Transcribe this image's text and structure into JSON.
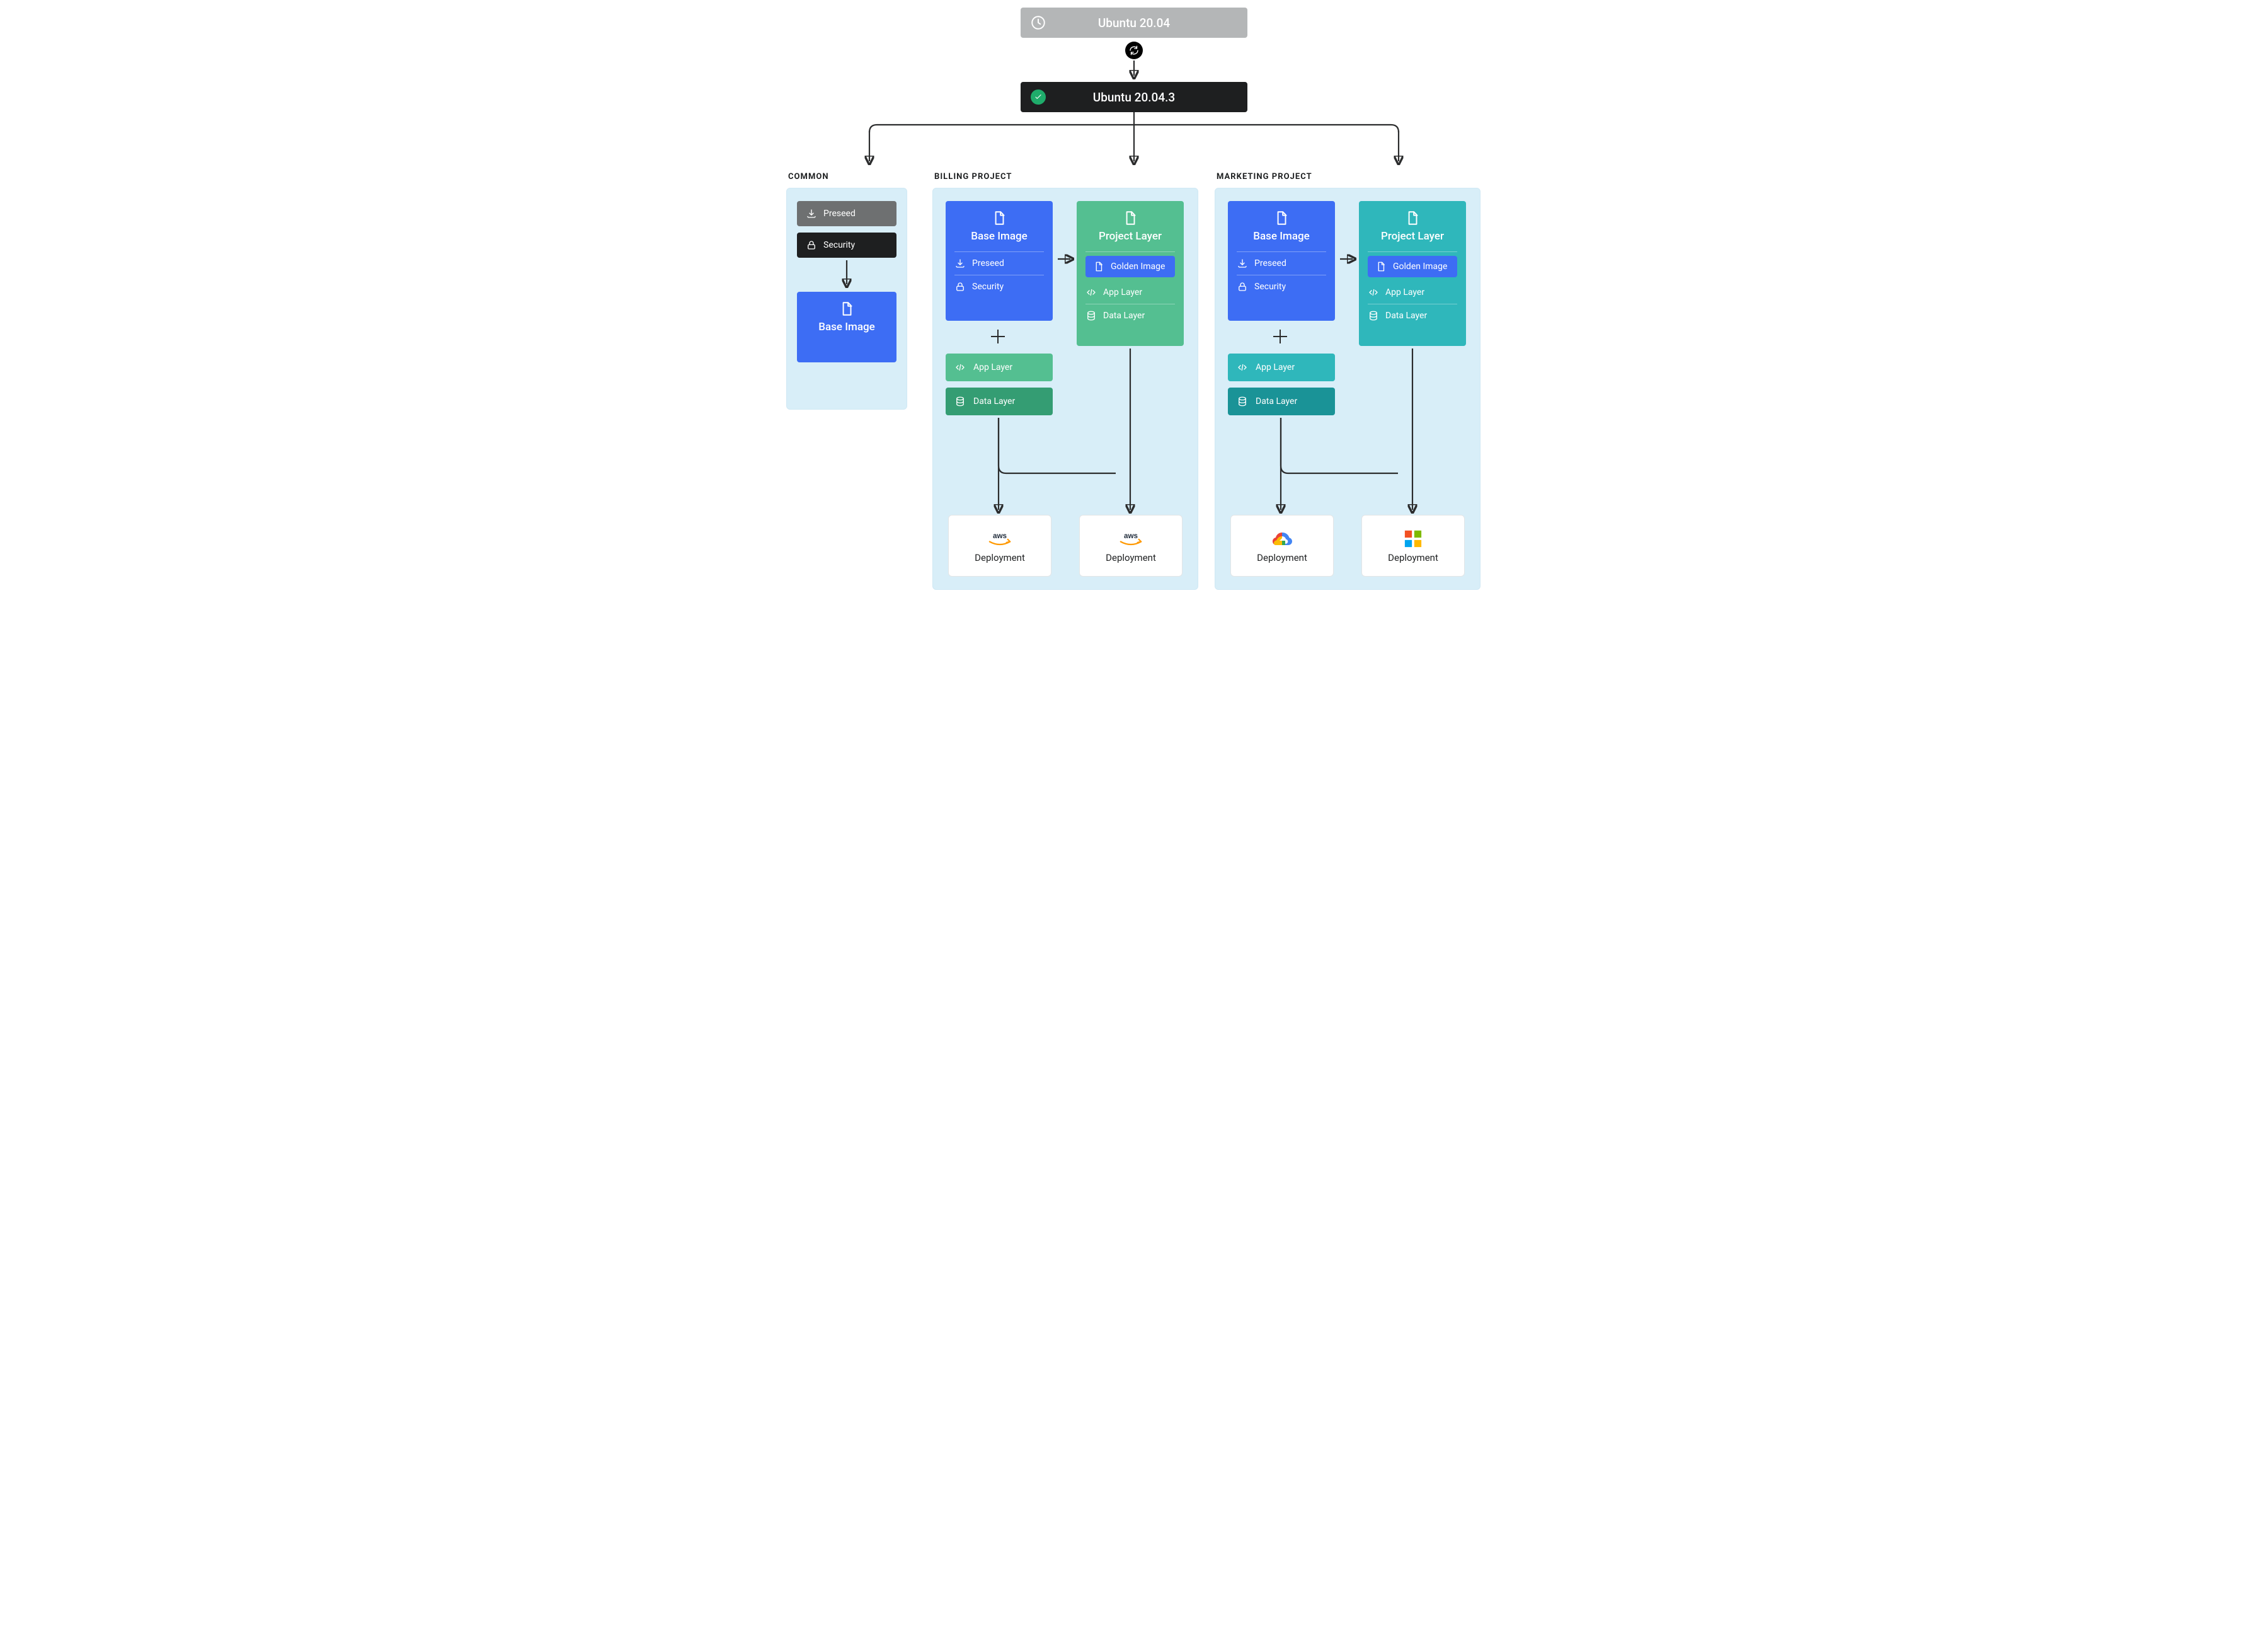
{
  "top": {
    "parent_label": "Ubuntu 20.04",
    "refresh_icon": "refresh-icon",
    "child_label": "Ubuntu 20.04.3"
  },
  "sections": {
    "common": {
      "title": "COMMON",
      "items": {
        "preseed": "Preseed",
        "security": "Security"
      },
      "base_image": "Base Image"
    },
    "billing": {
      "title": "BILLING PROJECT",
      "base": {
        "title": "Base Image",
        "preseed": "Preseed",
        "security": "Security",
        "app_layer": "App Layer",
        "data_layer": "Data Layer"
      },
      "project": {
        "title": "Project Layer",
        "golden_image": "Golden Image",
        "app_layer": "App Layer",
        "data_layer": "Data Layer"
      },
      "deployments": {
        "left": {
          "provider": "aws",
          "label": "Deployment"
        },
        "right": {
          "provider": "aws",
          "label": "Deployment"
        }
      }
    },
    "marketing": {
      "title": "MARKETING PROJECT",
      "base": {
        "title": "Base Image",
        "preseed": "Preseed",
        "security": "Security",
        "app_layer": "App Layer",
        "data_layer": "Data Layer"
      },
      "project": {
        "title": "Project Layer",
        "golden_image": "Golden Image",
        "app_layer": "App Layer",
        "data_layer": "Data Layer"
      },
      "deployments": {
        "left": {
          "provider": "gcp",
          "label": "Deployment"
        },
        "right": {
          "provider": "azure",
          "label": "Deployment"
        }
      }
    }
  }
}
